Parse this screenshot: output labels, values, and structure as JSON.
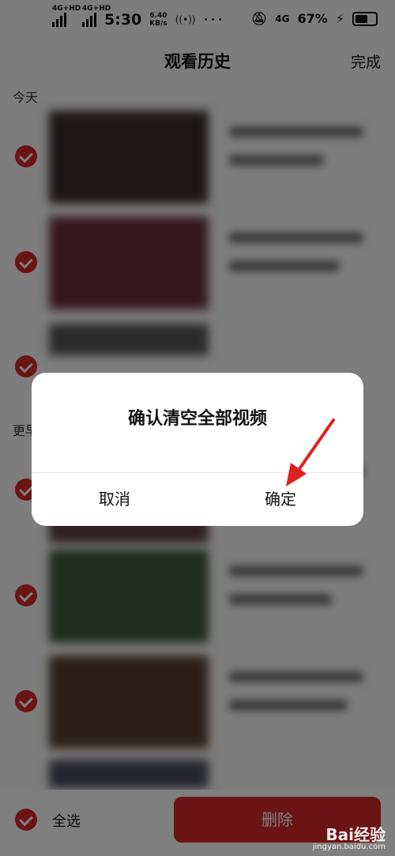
{
  "status_bar": {
    "network1": "4G+HD",
    "network2": "4G+HD",
    "time": "5:30",
    "speed_value": "6.40",
    "speed_unit": "KB/s",
    "dots": "• • •",
    "net_right": "4G",
    "battery_text": "67%",
    "battery_level": 0.67
  },
  "header": {
    "title": "观看历史",
    "done_label": "完成"
  },
  "sections": {
    "today": "今天",
    "earlier": "更早"
  },
  "bottom_bar": {
    "select_all_label": "全选",
    "delete_label": "删除"
  },
  "dialog": {
    "title": "确认清空全部视频",
    "cancel_label": "取消",
    "confirm_label": "确定"
  },
  "watermark": {
    "brand": "Bai经验",
    "url": "jingyan.baidu.com"
  },
  "colors": {
    "accent_red": "#d6282a"
  }
}
